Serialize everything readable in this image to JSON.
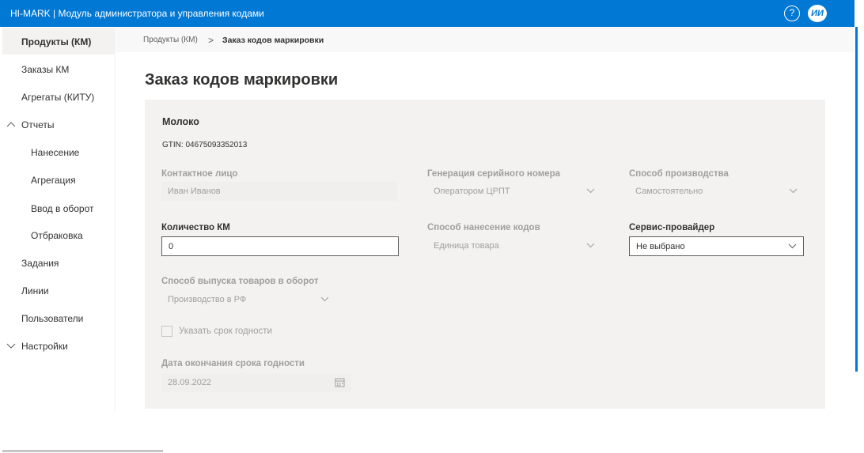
{
  "app": {
    "title": "HI-MARK | Модуль администратора и управления кодами",
    "help_glyph": "?",
    "avatar_initials": "ИИ"
  },
  "sidebar": {
    "items": [
      {
        "label": "Продукты (КМ)"
      },
      {
        "label": "Заказы КМ"
      },
      {
        "label": "Агрегаты (КИТУ)"
      },
      {
        "label": "Отчеты"
      },
      {
        "label": "Нанесение"
      },
      {
        "label": "Агрегация"
      },
      {
        "label": "Ввод в оборот"
      },
      {
        "label": "Отбраковка"
      },
      {
        "label": "Задания"
      },
      {
        "label": "Линии"
      },
      {
        "label": "Пользователи"
      },
      {
        "label": "Настройки"
      }
    ]
  },
  "breadcrumb": {
    "parent": "Продукты (КМ)",
    "separator": ">",
    "current": "Заказ кодов маркировки"
  },
  "page": {
    "title": "Заказ кодов маркировки"
  },
  "product": {
    "name": "Молоко",
    "gtin": "GTIN: 04675093352013"
  },
  "form": {
    "contact": {
      "label": "Контактное лицо",
      "value": "Иван Иванов"
    },
    "serial_gen": {
      "label": "Генерация серийного номера",
      "value": "Оператором ЦРПТ"
    },
    "production_method": {
      "label": "Способ производства",
      "value": "Самостоятельно"
    },
    "quantity": {
      "label": "Количество КМ",
      "value": "0"
    },
    "apply_method": {
      "label": "Способ нанесение кодов",
      "value": "Единица товара"
    },
    "service_provider": {
      "label": "Сервис-провайдер",
      "value": "Не выбрано"
    },
    "release_method": {
      "label": "Способ выпуска товаров в оборот",
      "value": "Производство в РФ"
    },
    "expiry_checkbox": {
      "label": "Указать срок годности"
    },
    "expiry_date": {
      "label": "Дата окончания срока годности",
      "value": "28.09.2022"
    }
  },
  "colors": {
    "accent": "#0078d4",
    "card_bg": "#f3f2f1",
    "disabled_text": "#a19f9d"
  }
}
